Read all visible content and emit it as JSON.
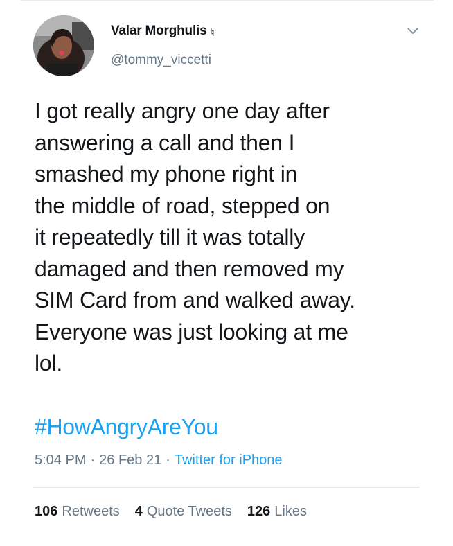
{
  "tweet": {
    "author": {
      "display_name": "Valar Morghulis",
      "name_glyph": "♮",
      "handle": "@tommy_viccetti"
    },
    "text_lines": [
      "I got really angry one day after",
      "answering a call and then I",
      "smashed my phone right in",
      "the middle of road, stepped on",
      "it repeatedly till it was totally",
      "damaged and then removed my",
      "SIM Card from and walked away.",
      "Everyone was just looking at me",
      "lol."
    ],
    "hashtag": "#HowAngryAreYou",
    "time": "5:04 PM",
    "date": "26 Feb 21",
    "source": "Twitter for iPhone",
    "separator": "·"
  },
  "stats": {
    "retweets": {
      "count": "106",
      "label": "Retweets"
    },
    "quote_tweets": {
      "count": "4",
      "label": "Quote Tweets"
    },
    "likes": {
      "count": "126",
      "label": "Likes"
    }
  },
  "icons": {
    "caret": "chevron-down-icon",
    "avatar": "profile-photo"
  },
  "colors": {
    "link": "#1da1f2",
    "secondary_text": "#657786",
    "primary_text": "#14171a",
    "divider": "#e1e8ed"
  }
}
